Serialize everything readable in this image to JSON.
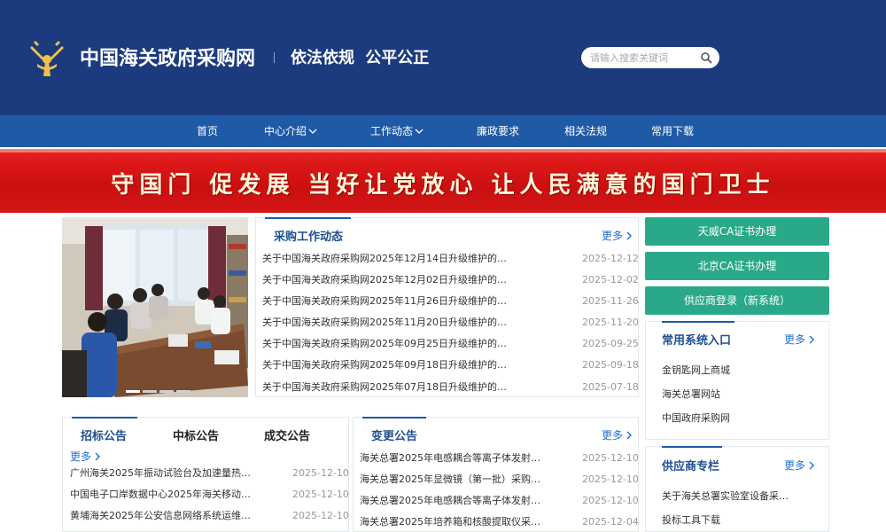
{
  "header": {
    "site_name": "中国海关政府采购网",
    "slogan": "依法依规  公平公正",
    "search_placeholder": "请输入搜索关键词"
  },
  "nav": {
    "items": [
      {
        "label": "首页"
      },
      {
        "label": "中心介绍"
      },
      {
        "label": "工作动态"
      },
      {
        "label": "廉政要求"
      },
      {
        "label": "相关法规"
      },
      {
        "label": "常用下载"
      }
    ]
  },
  "banner": {
    "text": "守国门 促发展   当好让党放心 让人民满意的国门卫士"
  },
  "carousel": {
    "slide_count": 4,
    "active_index": 0
  },
  "news": {
    "title": "采购工作动态",
    "more": "更多",
    "items": [
      {
        "title": "关于中国海关政府采购网2025年12月14日升级维护的…",
        "date": "2025-12-12"
      },
      {
        "title": "关于中国海关政府采购网2025年12月02日升级维护的…",
        "date": "2025-12-02"
      },
      {
        "title": "关于中国海关政府采购网2025年11月26日升级维护的…",
        "date": "2025-11-26"
      },
      {
        "title": "关于中国海关政府采购网2025年11月20日升级维护的…",
        "date": "2025-11-20"
      },
      {
        "title": "关于中国海关政府采购网2025年09月25日升级维护的…",
        "date": "2025-09-25"
      },
      {
        "title": "关于中国海关政府采购网2025年09月18日升级维护的…",
        "date": "2025-09-18"
      },
      {
        "title": "关于中国海关政府采购网2025年07月18日升级维护的…",
        "date": "2025-07-18"
      }
    ]
  },
  "quick_buttons": [
    {
      "label": "天威CA证书办理"
    },
    {
      "label": "北京CA证书办理"
    },
    {
      "label": "供应商登录（新系统）"
    }
  ],
  "systems": {
    "title": "常用系统入口",
    "more": "更多",
    "links": [
      {
        "label": "金钥匙网上商城"
      },
      {
        "label": "海关总署网站"
      },
      {
        "label": "中国政府采购网"
      }
    ]
  },
  "supplier": {
    "title": "供应商专栏",
    "more": "更多",
    "links": [
      {
        "label": "关于海关总署实验室设备采…"
      },
      {
        "label": "投标工具下载"
      }
    ]
  },
  "tenders": {
    "tabs": [
      {
        "label": "招标公告"
      },
      {
        "label": "中标公告"
      },
      {
        "label": "成交公告"
      }
    ],
    "more": "更多",
    "items": [
      {
        "title": "广州海关2025年振动试验台及加速量热…",
        "date": "2025-12-10"
      },
      {
        "title": "中国电子口岸数据中心2025年海关移动…",
        "date": "2025-12-10"
      },
      {
        "title": "黄埔海关2025年公安信息网络系统运维…",
        "date": "2025-12-10"
      }
    ]
  },
  "changes": {
    "title": "变更公告",
    "more": "更多",
    "items": [
      {
        "title": "海关总署2025年电感耦合等离子体发射…",
        "date": "2025-12-10"
      },
      {
        "title": "海关总署2025年显微镜（第一批）采购…",
        "date": "2025-12-10"
      },
      {
        "title": "海关总署2025年电感耦合等离子体发射…",
        "date": "2025-12-10"
      },
      {
        "title": "海关总署2025年培养箱和核酸提取仪采…",
        "date": "2025-12-04"
      }
    ]
  },
  "colors": {
    "header_bg": "#1c3b7e",
    "nav_bg": "#1f5aa6",
    "banner_red": "#d51617",
    "green": "#2aa98a",
    "title_blue": "#1f4f8f",
    "link_blue": "#1f6fd0"
  }
}
